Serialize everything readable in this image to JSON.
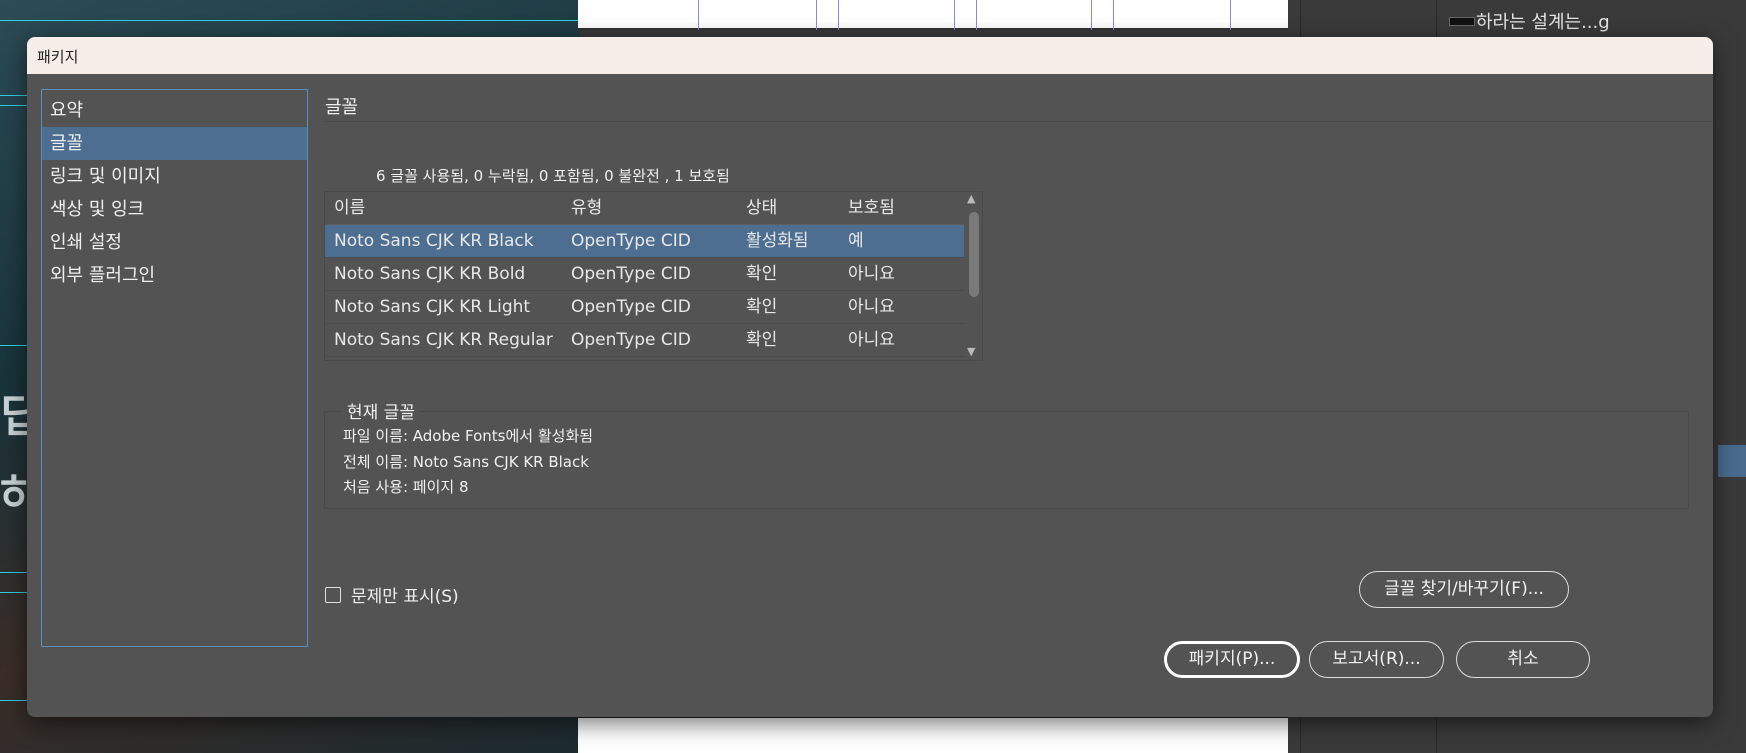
{
  "background": {
    "layers_row_label": "하라는 설계는...g",
    "glyph_1": "딥",
    "glyph_2": "하"
  },
  "dialog": {
    "title": "패키지",
    "nav": [
      "요약",
      "글꼴",
      "링크 및 이미지",
      "색상 및 잉크",
      "인쇄 설정",
      "외부 플러그인"
    ],
    "active_nav_index": 1,
    "section_title": "글꼴",
    "summary": "6 글꼴 사용됨, 0 누락됨, 0 포함됨, 0 불완전 , 1 보호됨",
    "table": {
      "headers": [
        "이름",
        "유형",
        "상태",
        "보호됨"
      ],
      "rows": [
        [
          "Noto Sans CJK KR Black",
          "OpenType CID",
          "활성화됨",
          "예"
        ],
        [
          "Noto Sans CJK KR Bold",
          "OpenType CID",
          "확인",
          "아니요"
        ],
        [
          "Noto Sans CJK KR Light",
          "OpenType CID",
          "확인",
          "아니요"
        ],
        [
          "Noto Sans CJK KR Regular",
          "OpenType CID",
          "확인",
          "아니요"
        ]
      ],
      "selected_row_index": 0
    },
    "current_font": {
      "legend": "현재 글꼴",
      "file_name": "파일 이름: Adobe Fonts에서 활성화됨",
      "full_name": "전체 이름: Noto Sans CJK KR Black",
      "first_use": "처음 사용: 페이지 8"
    },
    "checkbox_label": "문제만 표시(S)",
    "checkbox_checked": false,
    "buttons": {
      "find_font": "글꼴 찾기/바꾸기(F)...",
      "package": "패키지(P)...",
      "report": "보고서(R)...",
      "cancel": "취소"
    },
    "colors": {
      "selection": "#4d6e90",
      "dialog_bg": "#535353",
      "titlebar_bg": "#f7eeea"
    }
  }
}
